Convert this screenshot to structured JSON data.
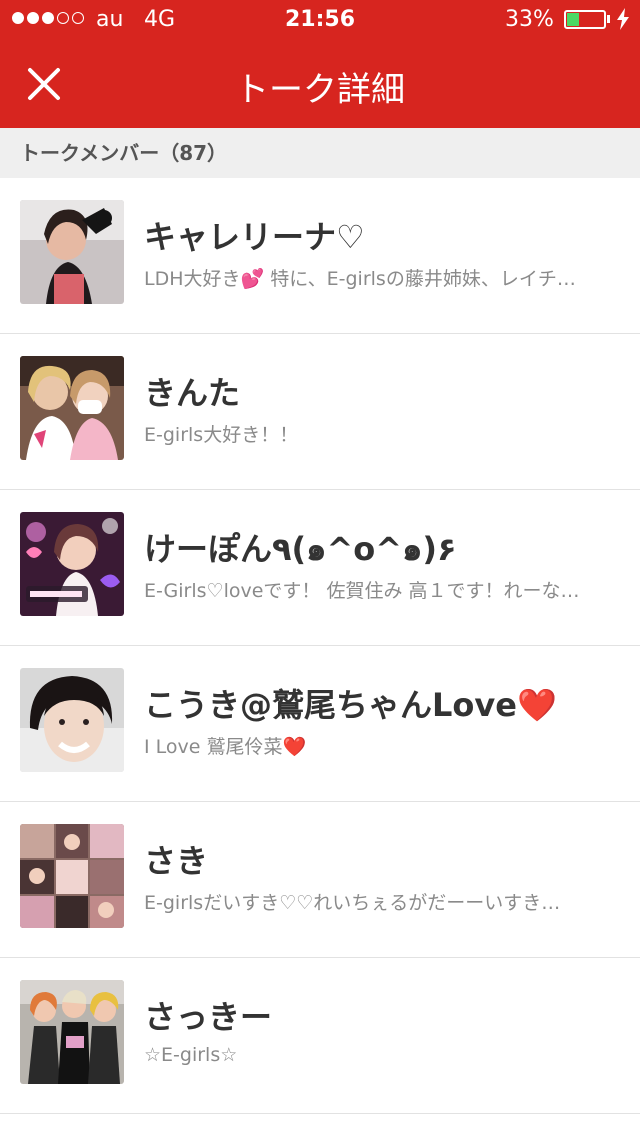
{
  "status_bar": {
    "carrier": "au",
    "network": "4G",
    "time": "21:56",
    "battery_percent_text": "33%",
    "battery_level": 0.33,
    "signal_bars_filled": 3,
    "signal_bars_total": 5
  },
  "nav": {
    "title": "トーク詳細",
    "close_icon": "close-icon"
  },
  "section": {
    "label": "トークメンバー（87）"
  },
  "members": [
    {
      "name": "キャレリーナ♡",
      "status": "LDH大好き💕 特に、E-girlsの藤井姉妹、レイチ…"
    },
    {
      "name": "きんた",
      "status": "E-girls大好き！！"
    },
    {
      "name": "けーぽん٩(๑^o^๑)۶",
      "status": "E-Girls♡loveです！ 佐賀住み 高１です！れーな…"
    },
    {
      "name": "こうき@鷲尾ちゃんLove❤️",
      "status": "I Love 鷲尾伶菜❤️"
    },
    {
      "name": "さき",
      "status": "E-girlsだいすき♡♡れいちぇるがだーーいすき…"
    },
    {
      "name": "さっきー",
      "status": "☆E-girls☆"
    }
  ],
  "colors": {
    "brand_red": "#d7251f",
    "section_bg": "#efefef",
    "name_text": "#333333",
    "status_text": "#8a8a8a",
    "battery_green": "#4cd964"
  }
}
